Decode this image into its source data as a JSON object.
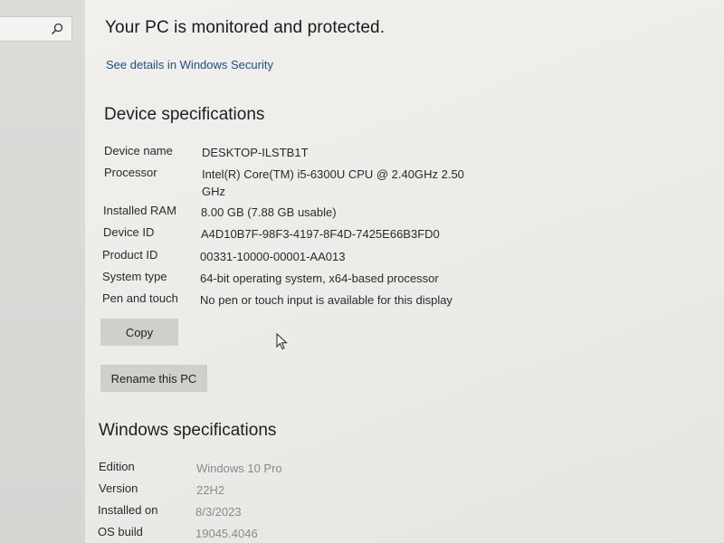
{
  "sidebar": {
    "search_icon": "search-icon"
  },
  "security": {
    "status_text": "Your PC is monitored and protected.",
    "link_text": "See details in Windows Security"
  },
  "device": {
    "section_title": "Device specifications",
    "specs": [
      {
        "label": "Device name",
        "value": "DESKTOP-ILSTB1T"
      },
      {
        "label": "Processor",
        "value": "Intel(R) Core(TM) i5-6300U CPU @ 2.40GHz   2.50 GHz"
      },
      {
        "label": "Installed RAM",
        "value": "8.00 GB (7.88 GB usable)"
      },
      {
        "label": "Device ID",
        "value": "A4D10B7F-98F3-4197-8F4D-7425E66B3FD0"
      },
      {
        "label": "Product ID",
        "value": "00331-10000-00001-AA013"
      },
      {
        "label": "System type",
        "value": "64-bit operating system, x64-based processor"
      },
      {
        "label": "Pen and touch",
        "value": "No pen or touch input is available for this display"
      }
    ],
    "copy_label": "Copy",
    "rename_label": "Rename this PC"
  },
  "windows": {
    "section_title": "Windows specifications",
    "specs": [
      {
        "label": "Edition",
        "value": "Windows 10 Pro"
      },
      {
        "label": "Version",
        "value": "22H2"
      },
      {
        "label": "Installed on",
        "value": "8/3/2023"
      },
      {
        "label": "OS build",
        "value": "19045.4046"
      }
    ]
  },
  "colors": {
    "link": "#1e4f8a",
    "button_bg": "#cfcfcc",
    "background": "#ecebe7"
  }
}
